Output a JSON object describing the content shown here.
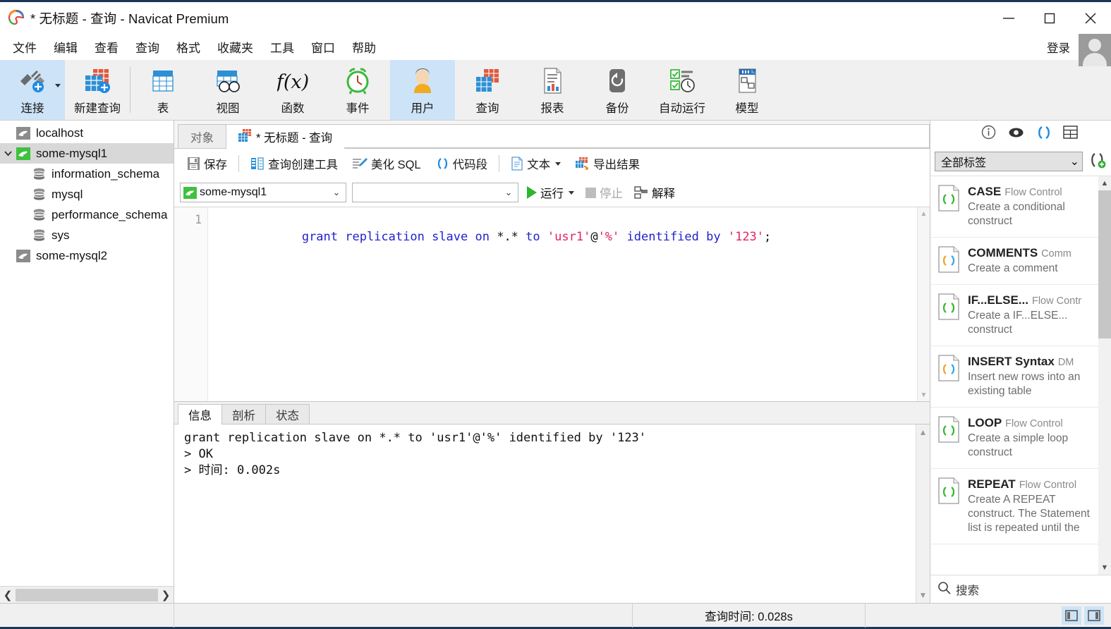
{
  "window": {
    "title": "* 无标题 - 查询 - Navicat Premium",
    "logo_icon": "navicat-logo-icon",
    "minimize_icon": "minimize-icon",
    "maximize_icon": "maximize-icon",
    "close_icon": "close-icon"
  },
  "menu": {
    "items": [
      {
        "label": "文件",
        "name": "menu-file"
      },
      {
        "label": "编辑",
        "name": "menu-edit"
      },
      {
        "label": "查看",
        "name": "menu-view"
      },
      {
        "label": "查询",
        "name": "menu-query"
      },
      {
        "label": "格式",
        "name": "menu-format"
      },
      {
        "label": "收藏夹",
        "name": "menu-favorites"
      },
      {
        "label": "工具",
        "name": "menu-tools"
      },
      {
        "label": "窗口",
        "name": "menu-window"
      },
      {
        "label": "帮助",
        "name": "menu-help"
      }
    ],
    "login_label": "登录",
    "avatar_icon": "user-avatar-icon"
  },
  "toolbar": {
    "items": [
      {
        "label": "连接",
        "icon": "connection-plug-icon",
        "selected": true,
        "has_caret": true
      },
      {
        "label": "新建查询",
        "icon": "new-query-icon",
        "selected": false,
        "has_caret": false
      },
      {
        "label": "表",
        "icon": "table-icon",
        "selected": false,
        "has_caret": false
      },
      {
        "label": "视图",
        "icon": "view-icon",
        "selected": false,
        "has_caret": false
      },
      {
        "label": "函数",
        "icon": "function-fx-icon",
        "selected": false,
        "has_caret": false
      },
      {
        "label": "事件",
        "icon": "event-clock-icon",
        "selected": false,
        "has_caret": false
      },
      {
        "label": "用户",
        "icon": "user-icon",
        "selected": true,
        "has_caret": false
      },
      {
        "label": "查询",
        "icon": "query-icon",
        "selected": false,
        "has_caret": false
      },
      {
        "label": "报表",
        "icon": "report-icon",
        "selected": false,
        "has_caret": false
      },
      {
        "label": "备份",
        "icon": "backup-icon",
        "selected": false,
        "has_caret": false
      },
      {
        "label": "自动运行",
        "icon": "automation-icon",
        "selected": false,
        "has_caret": false
      },
      {
        "label": "模型",
        "icon": "model-icon",
        "selected": false,
        "has_caret": false
      }
    ]
  },
  "sidebar": {
    "tree": [
      {
        "label": "localhost",
        "icon": "mysql-dolphin-grey-icon",
        "indent": 1,
        "selected": false,
        "expander": ""
      },
      {
        "label": "some-mysql1",
        "icon": "mysql-dolphin-green-icon",
        "indent": 0,
        "selected": true,
        "expander": "chevron-down-icon"
      },
      {
        "label": "information_schema",
        "icon": "database-icon",
        "indent": 2,
        "selected": false,
        "expander": ""
      },
      {
        "label": "mysql",
        "icon": "database-icon",
        "indent": 2,
        "selected": false,
        "expander": ""
      },
      {
        "label": "performance_schema",
        "icon": "database-icon",
        "indent": 2,
        "selected": false,
        "expander": ""
      },
      {
        "label": "sys",
        "icon": "database-icon",
        "indent": 2,
        "selected": false,
        "expander": ""
      },
      {
        "label": "some-mysql2",
        "icon": "mysql-dolphin-grey-icon",
        "indent": 1,
        "selected": false,
        "expander": ""
      }
    ],
    "scroll_left_icon": "chevron-left-icon",
    "scroll_right_icon": "chevron-right-icon"
  },
  "tabs": {
    "object_tab": "对象",
    "query_tab": "* 无标题 - 查询",
    "query_tab_icon": "query-tab-icon"
  },
  "query_toolbar": {
    "save": "保存",
    "save_icon": "save-icon",
    "query_builder": "查询创建工具",
    "query_builder_icon": "query-builder-icon",
    "beautify": "美化 SQL",
    "beautify_icon": "beautify-pen-icon",
    "snippets": "代码段",
    "snippets_icon": "code-parens-icon",
    "text": "文本",
    "text_icon": "text-file-icon",
    "export": "导出结果",
    "export_icon": "export-result-icon"
  },
  "connection_bar": {
    "connection_value": "some-mysql1",
    "connection_icon": "mysql-dolphin-green-icon",
    "database_value": "",
    "run_label": "运行",
    "run_icon": "play-triangle-icon",
    "stop_label": "停止",
    "stop_icon": "stop-square-icon",
    "explain_label": "解释",
    "explain_icon": "explain-icon"
  },
  "editor": {
    "line_number": "1",
    "tokens": [
      {
        "t": "grant replication",
        "c": "kw"
      },
      {
        "t": " ",
        "c": "op"
      },
      {
        "t": "slave on",
        "c": "kw"
      },
      {
        "t": " *.* ",
        "c": "op"
      },
      {
        "t": "to",
        "c": "kw"
      },
      {
        "t": " ",
        "c": "op"
      },
      {
        "t": "'usr1'",
        "c": "str"
      },
      {
        "t": "@",
        "c": "op"
      },
      {
        "t": "'%'",
        "c": "str"
      },
      {
        "t": " ",
        "c": "op"
      },
      {
        "t": "identified by",
        "c": "kw"
      },
      {
        "t": " ",
        "c": "op"
      },
      {
        "t": "'123'",
        "c": "str"
      },
      {
        "t": ";",
        "c": "op"
      }
    ],
    "plain_sql": "grant replication slave on *.* to 'usr1'@'%' identified by '123';"
  },
  "results": {
    "tabs": [
      {
        "label": "信息",
        "active": true
      },
      {
        "label": "剖析",
        "active": false
      },
      {
        "label": "状态",
        "active": false
      }
    ],
    "output": "grant replication slave on *.* to 'usr1'@'%' identified by '123'\n> OK\n> 时间: 0.002s"
  },
  "snippet_panel": {
    "icons": [
      {
        "name": "info-icon",
        "active": false
      },
      {
        "name": "eye-icon",
        "active": false
      },
      {
        "name": "code-parens-icon",
        "active": true
      },
      {
        "name": "grid-icon",
        "active": false
      }
    ],
    "filter_value": "全部标签",
    "add_icon": "add-snippet-icon",
    "items": [
      {
        "title": "CASE",
        "category": "Flow Control",
        "desc": "Create a conditional construct",
        "icon": "snippet-green-icon"
      },
      {
        "title": "COMMENTS",
        "category": "Comm",
        "desc": "Create a comment",
        "icon": "snippet-color-icon"
      },
      {
        "title": "IF...ELSE...",
        "category": "Flow Contr",
        "desc": "Create a IF...ELSE... construct",
        "icon": "snippet-green-icon"
      },
      {
        "title": "INSERT Syntax",
        "category": "DM",
        "desc": "Insert new rows into an existing table",
        "icon": "snippet-color-icon"
      },
      {
        "title": "LOOP",
        "category": "Flow Control",
        "desc": "Create a simple loop construct",
        "icon": "snippet-green-icon"
      },
      {
        "title": "REPEAT",
        "category": "Flow Control",
        "desc": "Create A REPEAT construct. The Statement list is repeated until the",
        "icon": "snippet-green-icon"
      }
    ],
    "search_placeholder": "搜索",
    "search_icon": "search-icon",
    "scroll_up_icon": "chevron-up-icon",
    "scroll_down_icon": "chevron-down-icon"
  },
  "statusbar": {
    "query_time": "查询时间: 0.028s",
    "left_panel_toggle_icon": "left-panel-toggle-icon",
    "right_panel_toggle_icon": "right-panel-toggle-icon"
  },
  "colors": {
    "accent_blue": "#1e8ae0",
    "selection_blue": "#cde3f7",
    "keyword": "#2222cc",
    "string": "#e0245e",
    "green": "#2db52d",
    "frame": "#1c3557"
  }
}
